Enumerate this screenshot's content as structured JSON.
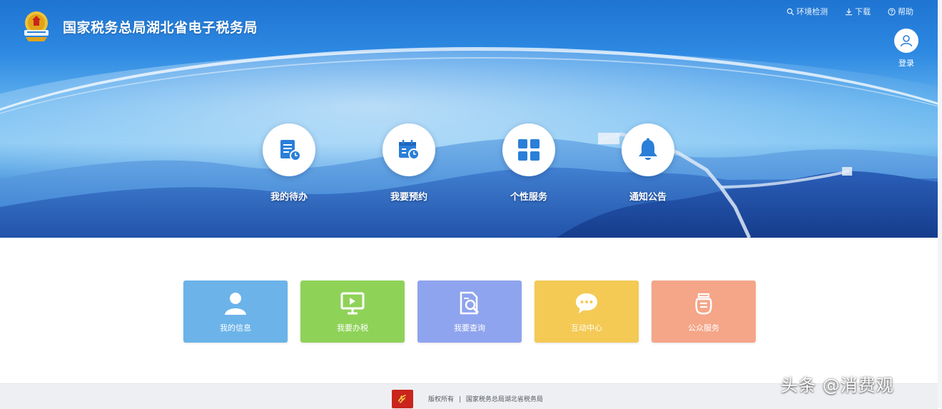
{
  "header": {
    "site_title": "国家税务总局湖北省电子税务局",
    "links": [
      {
        "label": "环境检测",
        "icon": "search-icon"
      },
      {
        "label": "下载",
        "icon": "download-icon"
      },
      {
        "label": "帮助",
        "icon": "help-icon"
      }
    ],
    "login_label": "登录"
  },
  "quick_nav": [
    {
      "label": "我的待办",
      "icon": "document-clock-icon"
    },
    {
      "label": "我要预约",
      "icon": "calendar-clock-icon"
    },
    {
      "label": "个性服务",
      "icon": "grid-icon"
    },
    {
      "label": "通知公告",
      "icon": "bell-icon"
    }
  ],
  "cards": [
    {
      "label": "我的信息",
      "icon": "user-icon",
      "color": "#6bb3e9"
    },
    {
      "label": "我要办税",
      "icon": "monitor-icon",
      "color": "#8fd258"
    },
    {
      "label": "我要查询",
      "icon": "search-document-icon",
      "color": "#8fa4ee"
    },
    {
      "label": "互动中心",
      "icon": "chat-icon",
      "color": "#f4ca55"
    },
    {
      "label": "公众服务",
      "icon": "pot-icon",
      "color": "#f5a588"
    }
  ],
  "footer": {
    "parts": [
      "版权所有",
      "|",
      "国家税务总局湖北省税务局"
    ]
  },
  "watermark": "头条 @消费观",
  "colors": {
    "hero_blue": "#2d89e2",
    "icon_blue": "#2a7fd8",
    "footer_red": "#c9241d"
  }
}
